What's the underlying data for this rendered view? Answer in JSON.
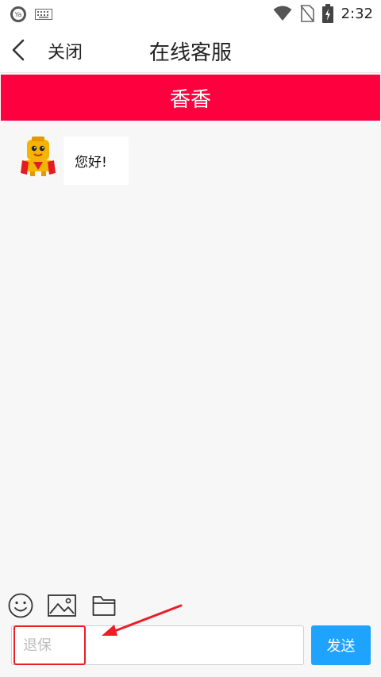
{
  "status_bar": {
    "time": "2:32",
    "icons": [
      "app-notification-icon",
      "keyboard-icon",
      "wifi-icon",
      "no-sim-icon",
      "battery-charging-icon"
    ]
  },
  "header": {
    "close_label": "关闭",
    "title": "在线客服"
  },
  "banner": {
    "agent_name": "香香"
  },
  "chat": {
    "messages": [
      {
        "sender": "agent",
        "text": "您好!"
      }
    ]
  },
  "toolbar": {
    "icons": [
      "emoji-icon",
      "image-icon",
      "folder-icon"
    ]
  },
  "composer": {
    "placeholder": "退保",
    "value": "",
    "send_label": "发送"
  },
  "colors": {
    "banner": "#ff003f",
    "send_button": "#1ea4ff",
    "annotation": "#ee1c25"
  }
}
